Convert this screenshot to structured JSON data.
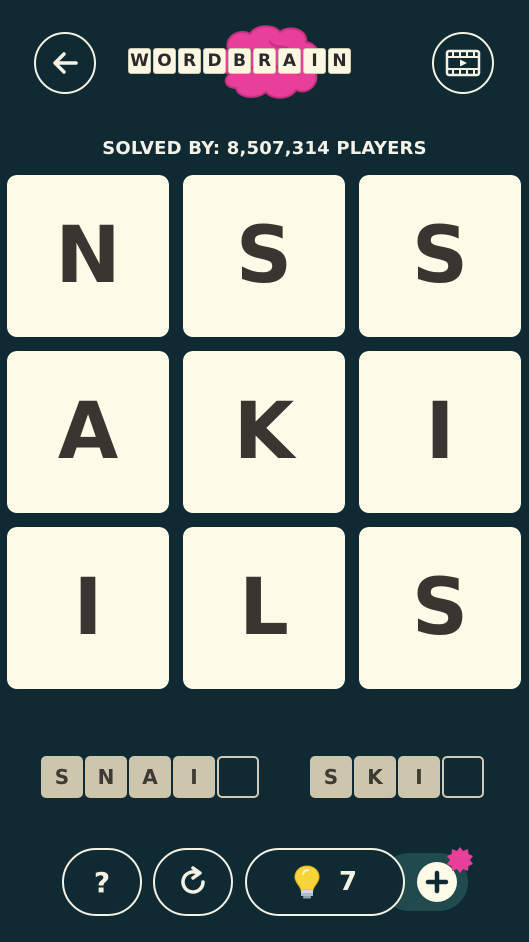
{
  "header": {
    "logo_letters": [
      "W",
      "O",
      "R",
      "D",
      "B",
      "R",
      "A",
      "I",
      "N"
    ],
    "back_icon": "back-arrow-icon",
    "video_icon": "video-play-icon"
  },
  "solved_text": "SOLVED BY: 8,507,314 PLAYERS",
  "grid": {
    "rows": [
      [
        "N",
        "S",
        "S"
      ],
      [
        "A",
        "K",
        "I"
      ],
      [
        "I",
        "L",
        "S"
      ]
    ]
  },
  "words": [
    {
      "letters": [
        "S",
        "N",
        "A",
        "I",
        ""
      ]
    },
    {
      "letters": [
        "S",
        "K",
        "I",
        ""
      ]
    }
  ],
  "controls": {
    "help_label": "?",
    "hint_count": "7",
    "hint_icon": "lightbulb-icon",
    "reset_icon": "refresh-icon",
    "add_icon": "plus-icon"
  },
  "colors": {
    "background": "#0f2a33",
    "tile": "#fdfbe8",
    "brain": "#e8409a",
    "badge": "#e8409a"
  }
}
